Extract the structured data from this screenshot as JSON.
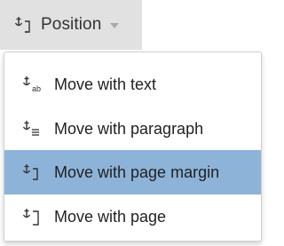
{
  "toolbar": {
    "position_label": "Position",
    "position_icon": "anchor-page-margin-icon",
    "dropdown_icon": "caret-down-icon"
  },
  "menu": {
    "selected_index": 2,
    "items": [
      {
        "label": "Move with text",
        "icon": "anchor-text-icon"
      },
      {
        "label": "Move with paragraph",
        "icon": "anchor-paragraph-icon"
      },
      {
        "label": "Move with page margin",
        "icon": "anchor-page-margin-icon"
      },
      {
        "label": "Move with page",
        "icon": "anchor-page-icon"
      }
    ]
  },
  "colors": {
    "button_bg": "#e1e1e1",
    "selected_bg": "#8db3d9",
    "text": "#222222",
    "icon": "#333333"
  }
}
